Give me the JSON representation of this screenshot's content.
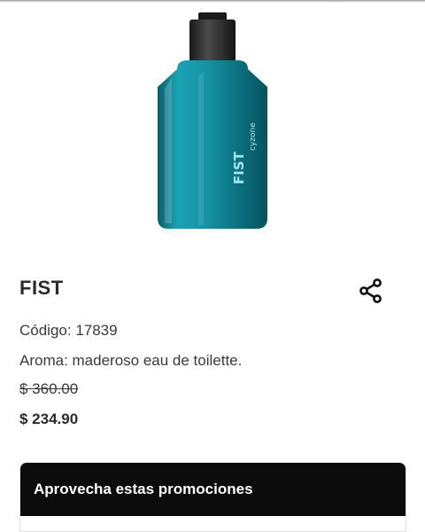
{
  "product": {
    "name": "FIST",
    "bottle_label": "FIST",
    "bottle_brand": "cyzone",
    "code": "Código: 17839",
    "aroma": "Aroma: maderoso eau de toilette.",
    "old_price": "$ 360.00",
    "price": "$ 234.90"
  },
  "icons": {
    "share": "share-icon"
  },
  "promotions": {
    "title": "Aprovecha estas promociones"
  },
  "colors": {
    "bottle": "#128a99",
    "promo_header": "#0c0c0c"
  }
}
